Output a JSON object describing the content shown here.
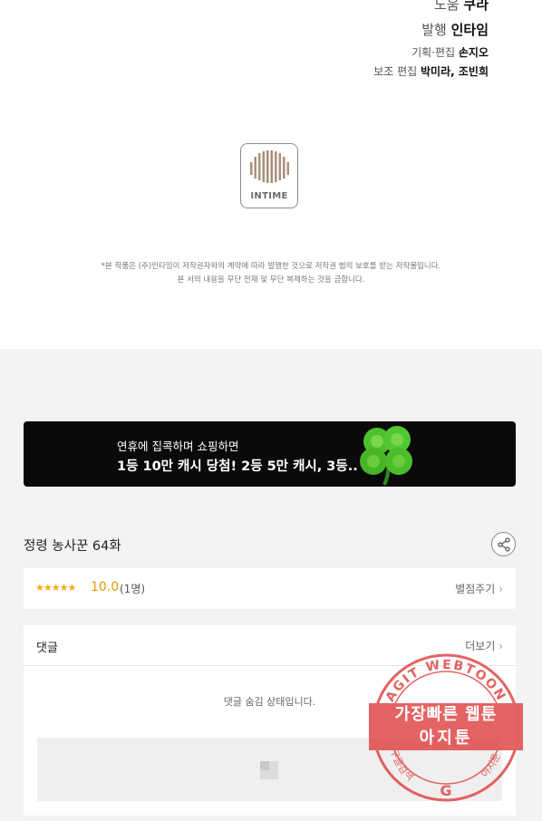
{
  "credits": [
    {
      "label": "도움",
      "value": "쿠라"
    },
    {
      "label": "발행",
      "value": "인타임"
    },
    {
      "label": "기획·편집",
      "value": "손지오"
    },
    {
      "label": "보조 편집",
      "value": "박미라, 조빈희"
    }
  ],
  "logo": {
    "text": "INTIME"
  },
  "legal": {
    "line1": "*본 작품은 (주)인타임이 저작권자와의 계약에 따라 발행한 것으로 저작권 법의 보호를 받는 저작물입니다.",
    "line2": "본 서의 내용을 무단 전재 및 무단 복제하는 것을 금합니다."
  },
  "banner": {
    "line1": "연휴에 집콕하며 쇼핑하면",
    "line2": "1등 10만 캐시 당첨! 2등 5만 캐시, 3등.."
  },
  "episode": {
    "title": "정령 농사꾼 64화"
  },
  "rating": {
    "stars": "★★★★★",
    "score": "10.0",
    "count": "(1명)",
    "rate_label": "별점주기"
  },
  "comments": {
    "title": "댓글",
    "more_label": "더보기",
    "hidden_message": "댓글 숨김 상태입니다."
  },
  "watermark": {
    "ring_top": "AGIT WEBTOON",
    "line1": "가장빠른 웹툰",
    "line2": "아지툰",
    "ring_bottom_left": "구글검색",
    "ring_bottom_right": "아지툰",
    "color": "#e04848"
  },
  "icons": {
    "share": "share-icon",
    "chevron": "chevron-right-icon",
    "clover": "clover-icon",
    "logo": "intime-logo-icon"
  }
}
